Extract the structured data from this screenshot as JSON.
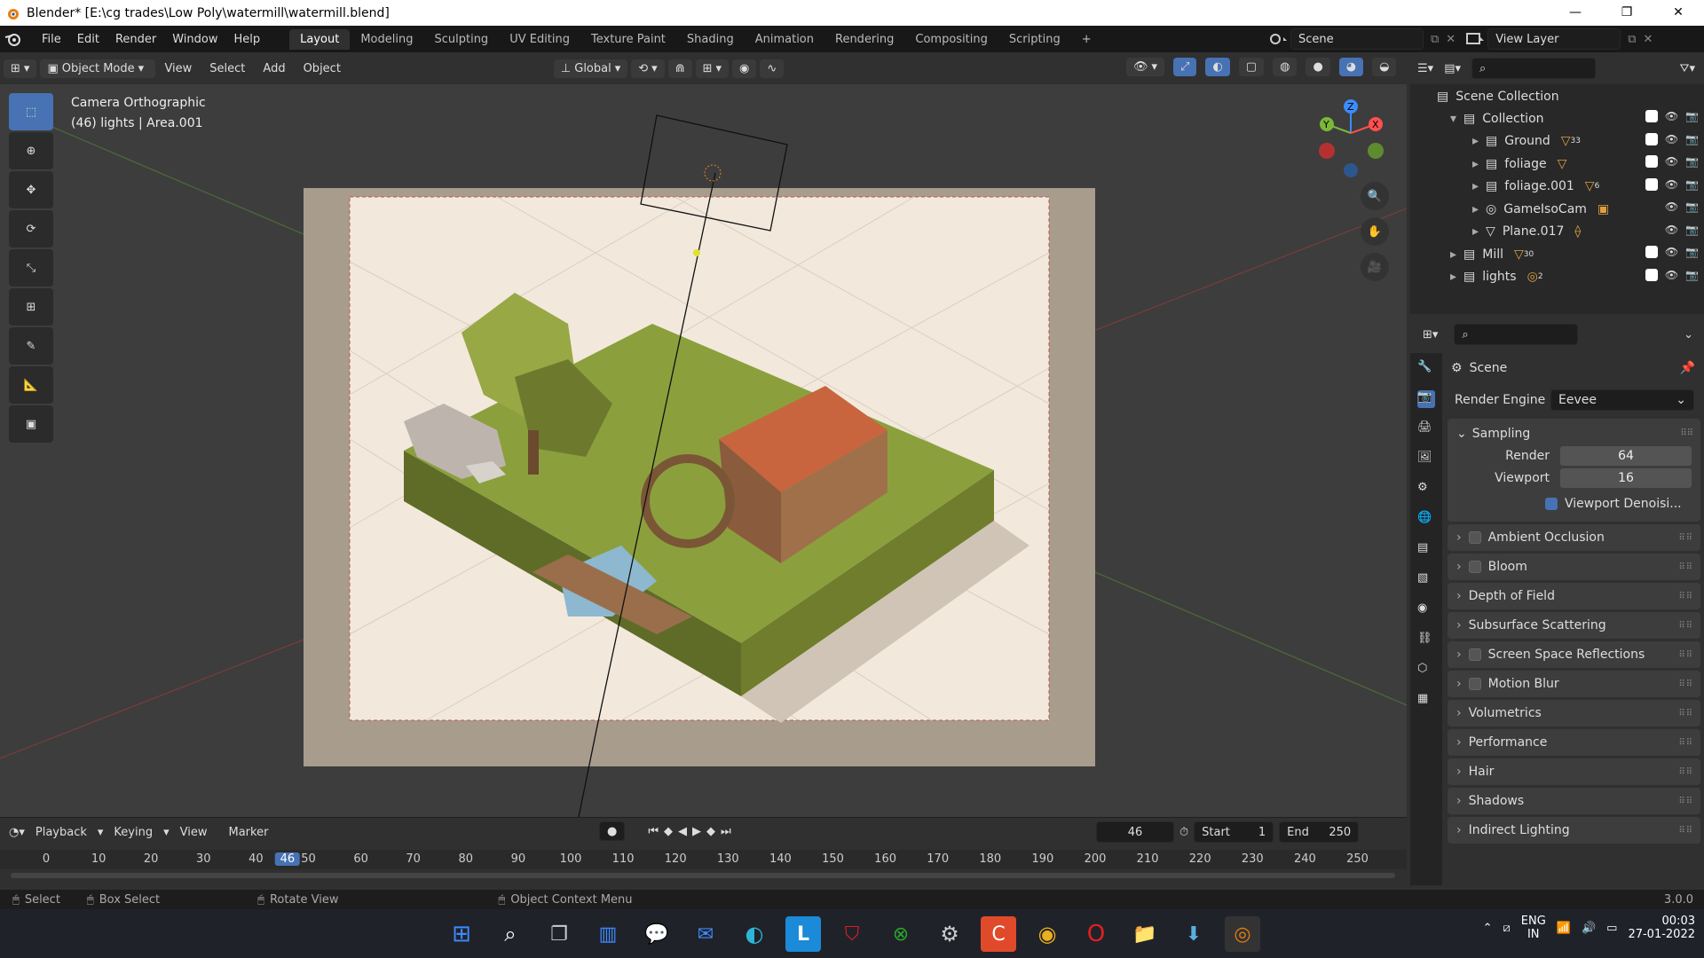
{
  "window_title": "Blender* [E:\\cg trades\\Low Poly\\watermill\\watermill.blend]",
  "window_controls": [
    "—",
    "❐",
    "✕"
  ],
  "menu": [
    "File",
    "Edit",
    "Render",
    "Window",
    "Help"
  ],
  "workspaces": [
    "Layout",
    "Modeling",
    "Sculpting",
    "UV Editing",
    "Texture Paint",
    "Shading",
    "Animation",
    "Rendering",
    "Compositing",
    "Scripting",
    "+"
  ],
  "scene_name": "Scene",
  "view_layer": "View Layer",
  "viewport_header": {
    "mode": "Object Mode",
    "menus": [
      "View",
      "Select",
      "Add",
      "Object"
    ],
    "orientation": "Global"
  },
  "viewport": {
    "camera_label": "Camera Orthographic",
    "info": "(46) lights | Area.001"
  },
  "gizmo": {
    "y": "Y",
    "z": "Z",
    "x": "X"
  },
  "outliner": {
    "root": "Scene Collection",
    "rows": [
      {
        "label": "Collection",
        "badge": ""
      },
      {
        "label": "Ground",
        "badge": "33"
      },
      {
        "label": "foliage",
        "badge": ""
      },
      {
        "label": "foliage.001",
        "badge": "6"
      },
      {
        "label": "GameIsoCam",
        "badge": ""
      },
      {
        "label": "Plane.017",
        "badge": ""
      },
      {
        "label": "Mill",
        "badge": "30"
      },
      {
        "label": "lights",
        "badge": "2"
      }
    ]
  },
  "properties": {
    "context": "Scene",
    "render_engine_label": "Render Engine",
    "render_engine": "Eevee",
    "sampling": "Sampling",
    "render_label": "Render",
    "render_samples": "64",
    "viewport_label": "Viewport",
    "viewport_samples": "16",
    "viewport_denoise": "Viewport Denoisi...",
    "panels": [
      {
        "label": "Ambient Occlusion",
        "checkbox": true
      },
      {
        "label": "Bloom",
        "checkbox": true
      },
      {
        "label": "Depth of Field",
        "checkbox": false
      },
      {
        "label": "Subsurface Scattering",
        "checkbox": false
      },
      {
        "label": "Screen Space Reflections",
        "checkbox": true
      },
      {
        "label": "Motion Blur",
        "checkbox": true
      },
      {
        "label": "Volumetrics",
        "checkbox": false
      },
      {
        "label": "Performance",
        "checkbox": false
      },
      {
        "label": "Hair",
        "checkbox": false
      },
      {
        "label": "Shadows",
        "checkbox": false
      },
      {
        "label": "Indirect Lighting",
        "checkbox": false
      }
    ]
  },
  "timeline": {
    "menus": [
      "Playback",
      "Keying",
      "View",
      "Marker"
    ],
    "current_frame": "46",
    "start_label": "Start",
    "start": "1",
    "end_label": "End",
    "end": "250",
    "ticks": [
      "0",
      "10",
      "20",
      "30",
      "40",
      "50",
      "60",
      "70",
      "80",
      "90",
      "100",
      "110",
      "120",
      "130",
      "140",
      "150",
      "160",
      "170",
      "180",
      "190",
      "200",
      "210",
      "220",
      "230",
      "240",
      "250"
    ]
  },
  "statusbar": {
    "select": "Select",
    "box_select": "Box Select",
    "rotate": "Rotate View",
    "context_menu": "Object Context Menu",
    "version": "3.0.0"
  },
  "taskbar": {
    "lang1": "ENG",
    "lang2": "IN",
    "time": "00:03",
    "date": "27-01-2022"
  }
}
